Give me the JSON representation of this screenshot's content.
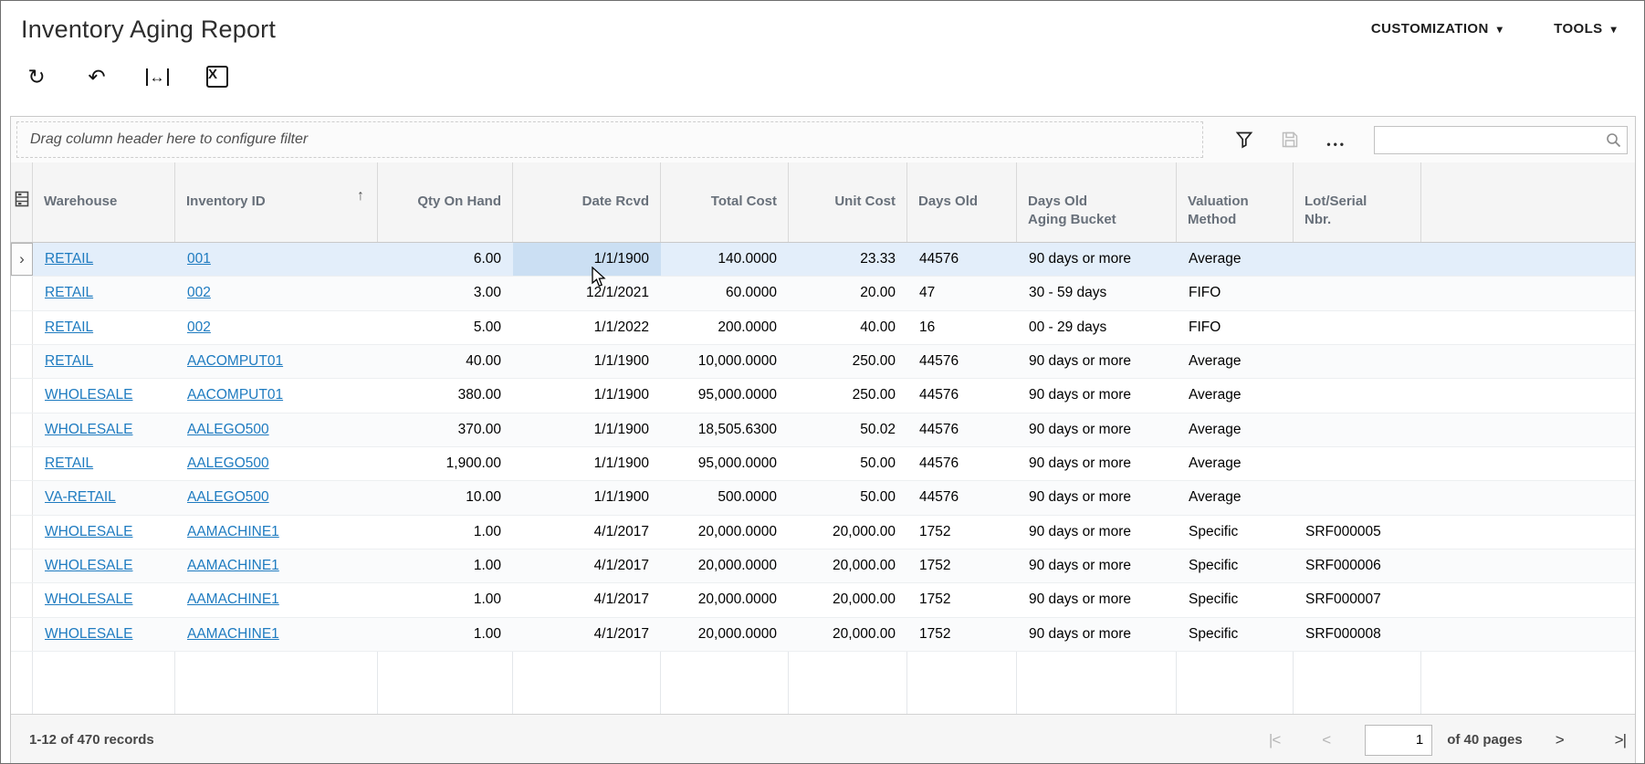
{
  "header": {
    "title": "Inventory Aging Report",
    "menus": [
      {
        "label": "CUSTOMIZATION"
      },
      {
        "label": "TOOLS"
      }
    ]
  },
  "icons": {
    "refresh_glyph": "↻",
    "undo_glyph": "↶",
    "fit_width_glyph": "↔",
    "export_excel_glyph": "X",
    "menu_caret": "▾",
    "ellipsis": "•••",
    "row_pointer": "›",
    "sort_ascending": "↑"
  },
  "filter_bar": {
    "hint": "Drag column header here to configure filter",
    "search_value": ""
  },
  "table": {
    "columns": [
      {
        "key": "selector",
        "label": [],
        "align": "left"
      },
      {
        "key": "warehouse",
        "label": [
          "Warehouse"
        ],
        "align": "left",
        "link": true
      },
      {
        "key": "inventory_id",
        "label": [
          "Inventory ID"
        ],
        "align": "left",
        "link": true
      },
      {
        "key": "qty_on_hand",
        "label": [
          "Qty On Hand"
        ],
        "align": "right"
      },
      {
        "key": "date_rcvd",
        "label": [
          "Date Rcvd"
        ],
        "align": "right"
      },
      {
        "key": "total_cost",
        "label": [
          "Total Cost"
        ],
        "align": "right"
      },
      {
        "key": "unit_cost",
        "label": [
          "Unit Cost"
        ],
        "align": "right"
      },
      {
        "key": "days_old",
        "label": [
          "Days Old"
        ],
        "align": "left"
      },
      {
        "key": "aging_bucket",
        "label": [
          "Days Old",
          "Aging Bucket"
        ],
        "align": "left"
      },
      {
        "key": "valuation_method",
        "label": [
          "Valuation",
          "Method"
        ],
        "align": "left"
      },
      {
        "key": "lot_serial",
        "label": [
          "Lot/Serial",
          "Nbr."
        ],
        "align": "left"
      }
    ],
    "sort": {
      "column": "inventory_id",
      "direction": "ascending"
    },
    "rows": [
      {
        "warehouse": "RETAIL",
        "inventory_id": "001",
        "qty_on_hand": "6.00",
        "date_rcvd": "1/1/1900",
        "total_cost": "140.0000",
        "unit_cost": "23.33",
        "days_old": "44576",
        "aging_bucket": "90 days or more",
        "valuation_method": "Average",
        "lot_serial": ""
      },
      {
        "warehouse": "RETAIL",
        "inventory_id": "002",
        "qty_on_hand": "3.00",
        "date_rcvd": "12/1/2021",
        "total_cost": "60.0000",
        "unit_cost": "20.00",
        "days_old": "47",
        "aging_bucket": "30 - 59 days",
        "valuation_method": "FIFO",
        "lot_serial": ""
      },
      {
        "warehouse": "RETAIL",
        "inventory_id": "002",
        "qty_on_hand": "5.00",
        "date_rcvd": "1/1/2022",
        "total_cost": "200.0000",
        "unit_cost": "40.00",
        "days_old": "16",
        "aging_bucket": "00 - 29 days",
        "valuation_method": "FIFO",
        "lot_serial": ""
      },
      {
        "warehouse": "RETAIL",
        "inventory_id": "AACOMPUT01",
        "qty_on_hand": "40.00",
        "date_rcvd": "1/1/1900",
        "total_cost": "10,000.0000",
        "unit_cost": "250.00",
        "days_old": "44576",
        "aging_bucket": "90 days or more",
        "valuation_method": "Average",
        "lot_serial": ""
      },
      {
        "warehouse": "WHOLESALE",
        "inventory_id": "AACOMPUT01",
        "qty_on_hand": "380.00",
        "date_rcvd": "1/1/1900",
        "total_cost": "95,000.0000",
        "unit_cost": "250.00",
        "days_old": "44576",
        "aging_bucket": "90 days or more",
        "valuation_method": "Average",
        "lot_serial": ""
      },
      {
        "warehouse": "WHOLESALE",
        "inventory_id": "AALEGO500",
        "qty_on_hand": "370.00",
        "date_rcvd": "1/1/1900",
        "total_cost": "18,505.6300",
        "unit_cost": "50.02",
        "days_old": "44576",
        "aging_bucket": "90 days or more",
        "valuation_method": "Average",
        "lot_serial": ""
      },
      {
        "warehouse": "RETAIL",
        "inventory_id": "AALEGO500",
        "qty_on_hand": "1,900.00",
        "date_rcvd": "1/1/1900",
        "total_cost": "95,000.0000",
        "unit_cost": "50.00",
        "days_old": "44576",
        "aging_bucket": "90 days or more",
        "valuation_method": "Average",
        "lot_serial": ""
      },
      {
        "warehouse": "VA-RETAIL",
        "inventory_id": "AALEGO500",
        "qty_on_hand": "10.00",
        "date_rcvd": "1/1/1900",
        "total_cost": "500.0000",
        "unit_cost": "50.00",
        "days_old": "44576",
        "aging_bucket": "90 days or more",
        "valuation_method": "Average",
        "lot_serial": ""
      },
      {
        "warehouse": "WHOLESALE",
        "inventory_id": "AAMACHINE1",
        "qty_on_hand": "1.00",
        "date_rcvd": "4/1/2017",
        "total_cost": "20,000.0000",
        "unit_cost": "20,000.00",
        "days_old": "1752",
        "aging_bucket": "90 days or more",
        "valuation_method": "Specific",
        "lot_serial": "SRF000005"
      },
      {
        "warehouse": "WHOLESALE",
        "inventory_id": "AAMACHINE1",
        "qty_on_hand": "1.00",
        "date_rcvd": "4/1/2017",
        "total_cost": "20,000.0000",
        "unit_cost": "20,000.00",
        "days_old": "1752",
        "aging_bucket": "90 days or more",
        "valuation_method": "Specific",
        "lot_serial": "SRF000006"
      },
      {
        "warehouse": "WHOLESALE",
        "inventory_id": "AAMACHINE1",
        "qty_on_hand": "1.00",
        "date_rcvd": "4/1/2017",
        "total_cost": "20,000.0000",
        "unit_cost": "20,000.00",
        "days_old": "1752",
        "aging_bucket": "90 days or more",
        "valuation_method": "Specific",
        "lot_serial": "SRF000007"
      },
      {
        "warehouse": "WHOLESALE",
        "inventory_id": "AAMACHINE1",
        "qty_on_hand": "1.00",
        "date_rcvd": "4/1/2017",
        "total_cost": "20,000.0000",
        "unit_cost": "20,000.00",
        "days_old": "1752",
        "aging_bucket": "90 days or more",
        "valuation_method": "Specific",
        "lot_serial": "SRF000008"
      }
    ]
  },
  "selection": {
    "row_index": 0,
    "column": "date_rcvd"
  },
  "footer": {
    "records_text": "1-12 of 470 records",
    "page_value": "1",
    "pages_text": "of 40 pages",
    "pager_icons": {
      "first": "|<",
      "prev": "<",
      "next": ">",
      "last": ">|"
    }
  },
  "colors": {
    "link": "#1e7bc0",
    "active_row_bg": "#e3eefa",
    "selected_cell_bg": "#cbdff3",
    "header_bg": "#f5f5f5",
    "footer_bg": "#f6f6f6"
  }
}
